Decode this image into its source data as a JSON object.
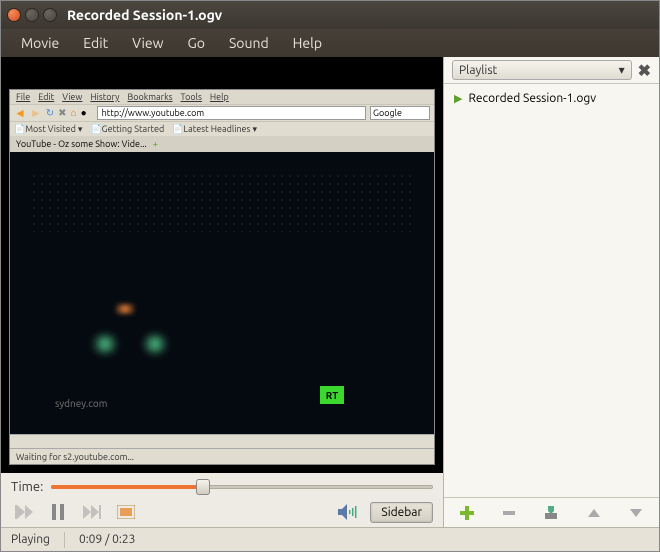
{
  "window": {
    "title": "Recorded Session-1.ogv"
  },
  "menubar": [
    "Movie",
    "Edit",
    "View",
    "Go",
    "Sound",
    "Help"
  ],
  "browser": {
    "menu": [
      "File",
      "Edit",
      "View",
      "History",
      "Bookmarks",
      "Tools",
      "Help"
    ],
    "url": "http://www.youtube.com",
    "search": "Google",
    "bookmarks": [
      "Most Visited",
      "Getting Started",
      "Latest Headlines"
    ],
    "tab": "YouTube - Oz some Show: Vide...",
    "status": "Waiting for s2.youtube.com...",
    "rt": "RT",
    "sydney": "sydney.com"
  },
  "playlist": {
    "header": "Playlist",
    "items": [
      {
        "name": "Recorded Session-1.ogv",
        "playing": true
      }
    ]
  },
  "controls": {
    "time_label": "Time:",
    "sidebar_btn": "Sidebar"
  },
  "status": {
    "state": "Playing",
    "time": "0:09 / 0:23"
  }
}
